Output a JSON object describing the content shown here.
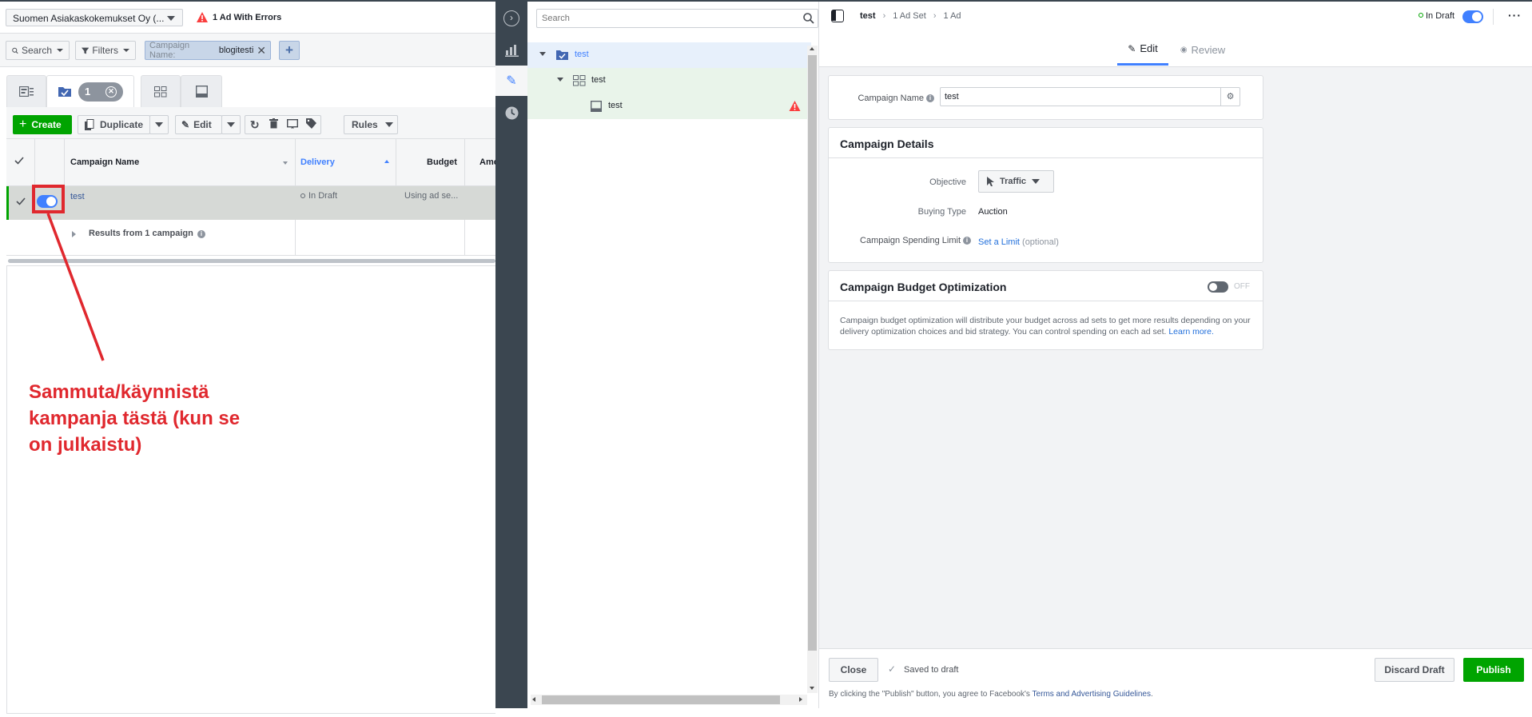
{
  "account": {
    "name": "Suomen Asiakaskokemukset Oy (..."
  },
  "errors": {
    "label": "1 Ad With Errors"
  },
  "filterbar": {
    "search_label": "Search",
    "filters_label": "Filters",
    "chip_key": "Campaign Name:",
    "chip_value": "blogitesti"
  },
  "tabs": {
    "selected_count": "1"
  },
  "toolbar": {
    "create_label": "Create",
    "duplicate_label": "Duplicate",
    "edit_label": "Edit",
    "rules_label": "Rules"
  },
  "grid": {
    "headers": {
      "name": "Campaign Name",
      "delivery": "Delivery",
      "budget": "Budget",
      "amount": "Amo"
    },
    "row": {
      "name": "test",
      "delivery": "In Draft",
      "budget": "Using ad se..."
    },
    "summary": "Results from 1 campaign"
  },
  "annotation": {
    "text": "Sammuta/käynnistä kampanja tästä (kun se on julkaistu)"
  },
  "tree": {
    "search_placeholder": "Search",
    "campaign": "test",
    "adset": "test",
    "ad": "test"
  },
  "editor": {
    "breadcrumb": {
      "campaign": "test",
      "adset": "1 Ad Set",
      "ad": "1 Ad"
    },
    "status": "In Draft",
    "tab_edit": "Edit",
    "tab_review": "Review",
    "campaign_name_label": "Campaign Name",
    "campaign_name_value": "test",
    "details_title": "Campaign Details",
    "objective_label": "Objective",
    "objective_value": "Traffic",
    "buying_type_label": "Buying Type",
    "buying_type_value": "Auction",
    "spending_limit_label": "Campaign Spending Limit",
    "spending_limit_link": "Set a Limit",
    "spending_limit_optional": "(optional)",
    "cbo_title": "Campaign Budget Optimization",
    "cbo_state": "OFF",
    "cbo_desc": "Campaign budget optimization will distribute your budget across ad sets to get more results depending on your delivery optimization choices and bid strategy. You can control spending on each ad set.",
    "cbo_learn": "Learn more.",
    "close_label": "Close",
    "saved_label": "Saved to draft",
    "discard_label": "Discard Draft",
    "publish_label": "Publish",
    "footer_prefix": "By clicking the \"Publish\" button, you agree to Facebook's",
    "footer_link": "Terms and Advertising Guidelines",
    "footer_suffix": "."
  },
  "colors": {
    "accent": "#4080ff",
    "green": "#00a400",
    "annotation": "#e0282e",
    "error": "#fa3e3e"
  }
}
